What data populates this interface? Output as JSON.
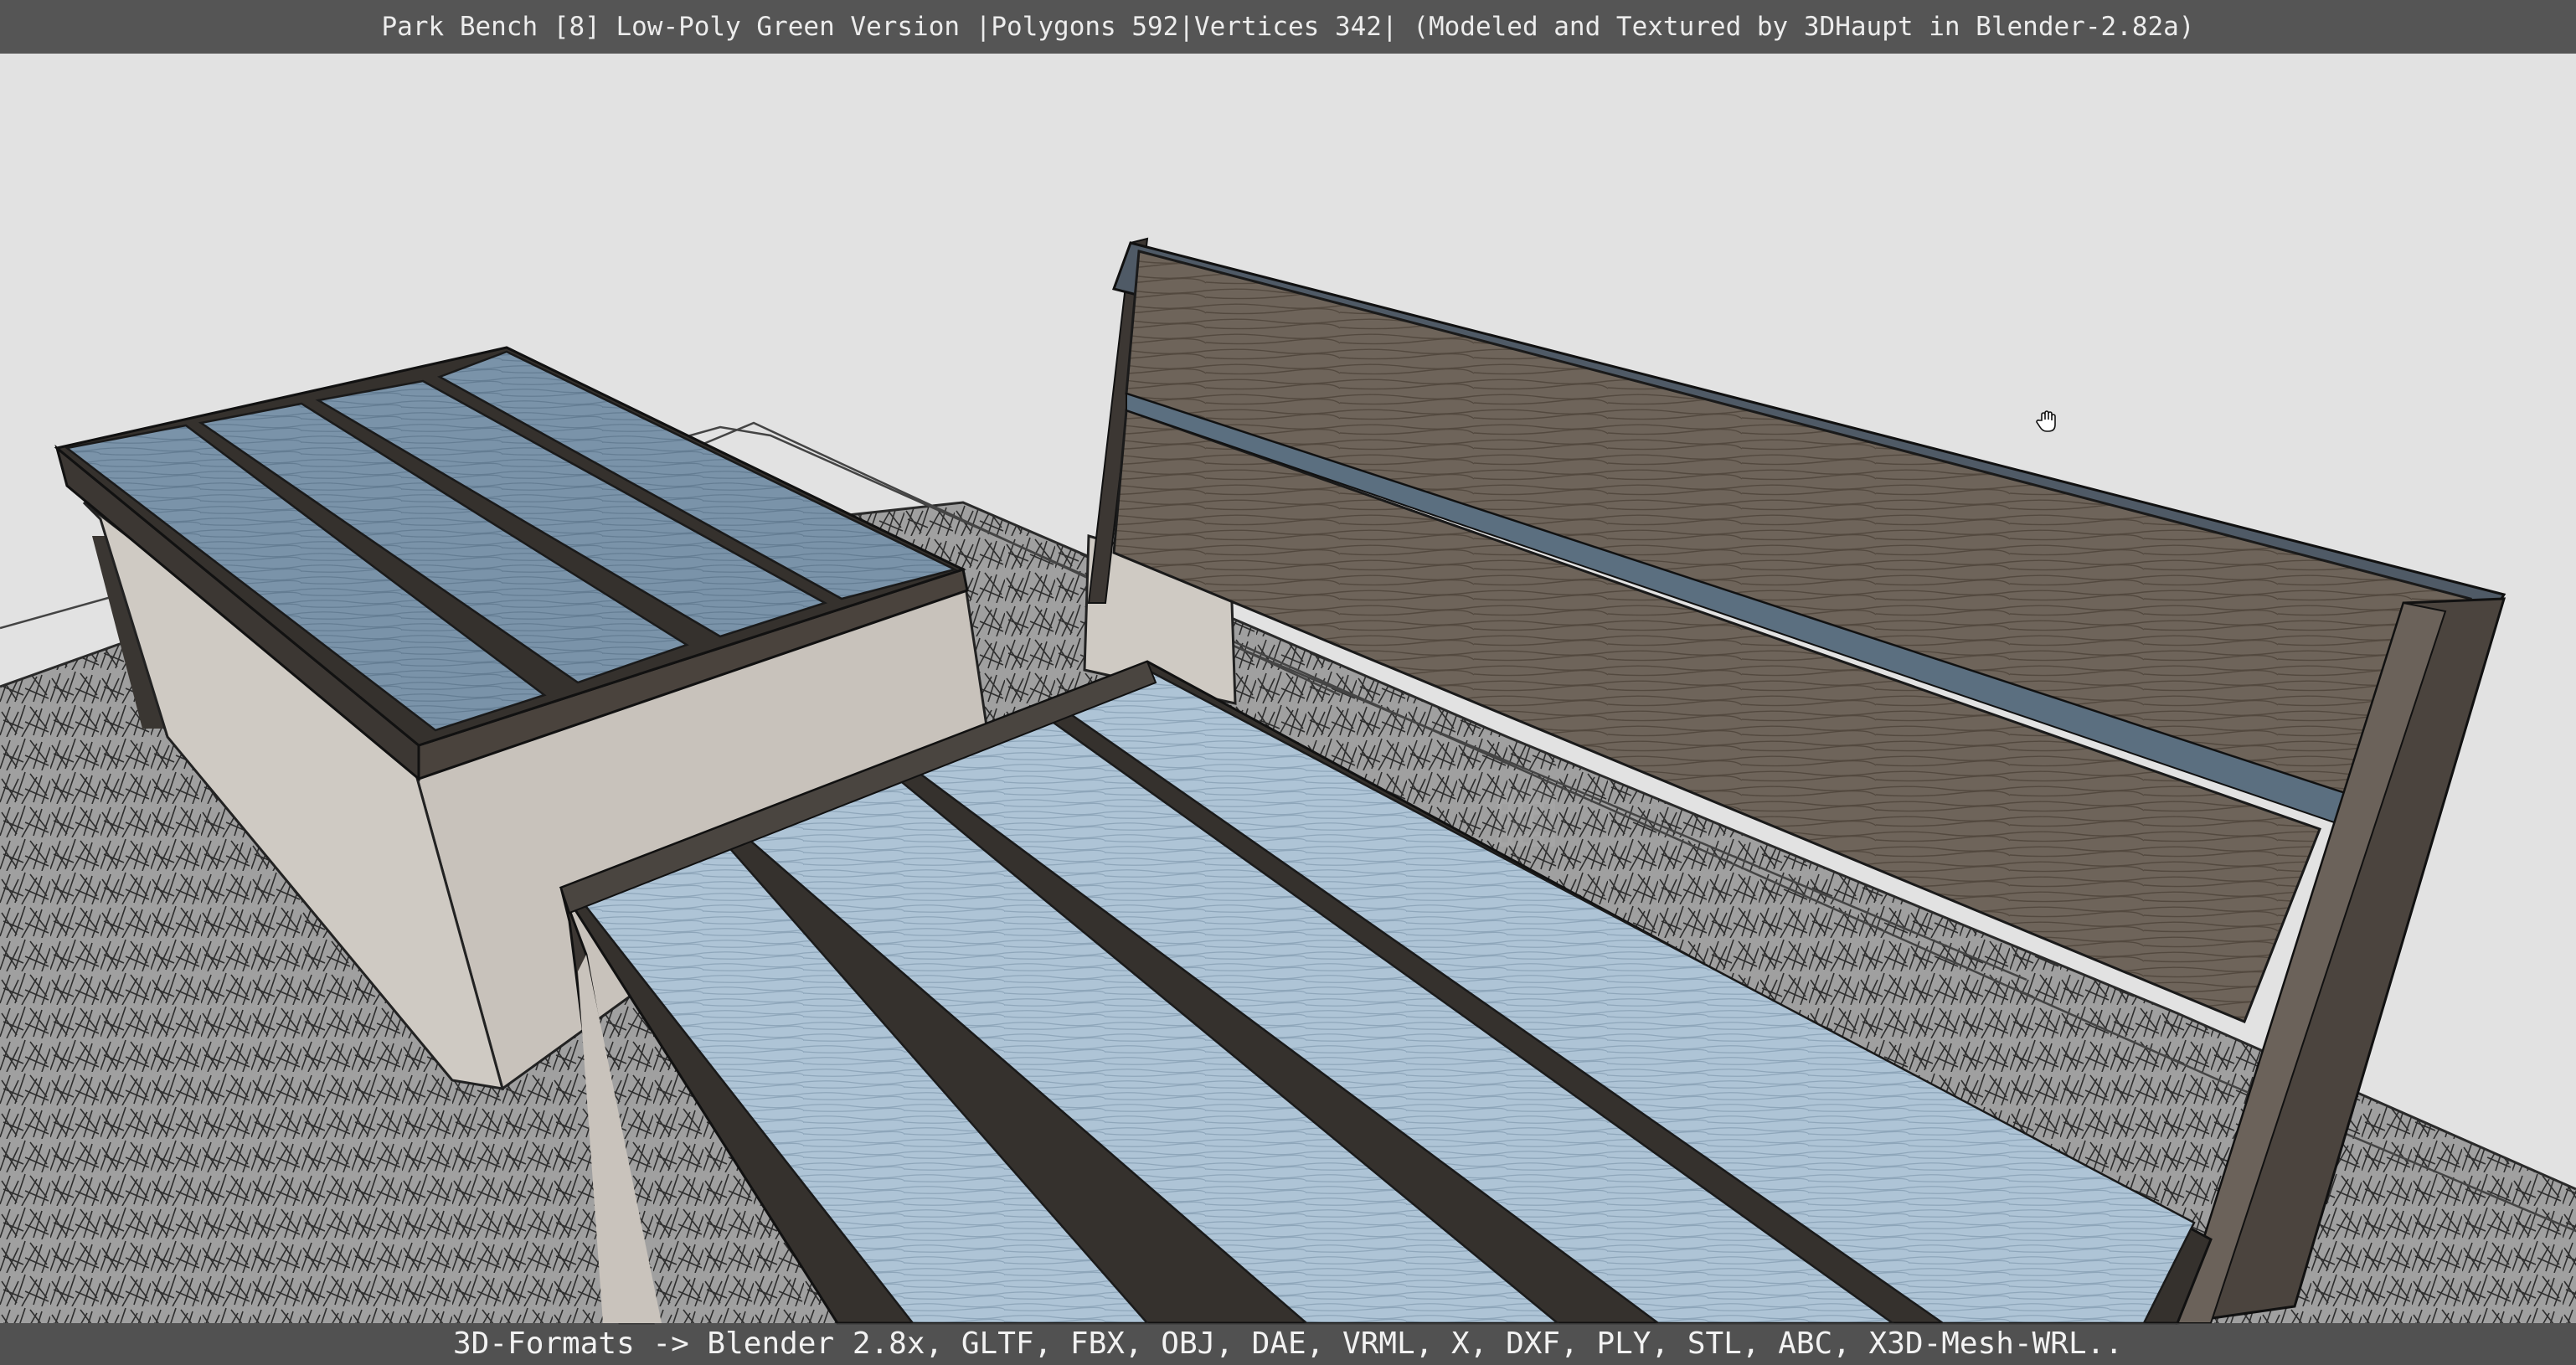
{
  "viewer": {
    "title": "Park Bench [8] Low-Poly Green Version |Polygons 592|Vertices 342| (Modeled and Textured by 3DHaupt in Blender-2.82a)",
    "formats": "3D-Formats -> Blender 2.8x, GLTF, FBX, OBJ, DAE, VRML, X, DXF, PLY, STL, ABC, X3D-Mesh-WRL..",
    "cursor_icon": "hand-grab-icon"
  },
  "colors": {
    "background": "#e2e2e2",
    "title_bar": "#555555",
    "seat_slat": "#a9c1d4",
    "back_slat": "#6f655c",
    "frame": "#3c3733",
    "side_panel": "#c6c1bb"
  }
}
